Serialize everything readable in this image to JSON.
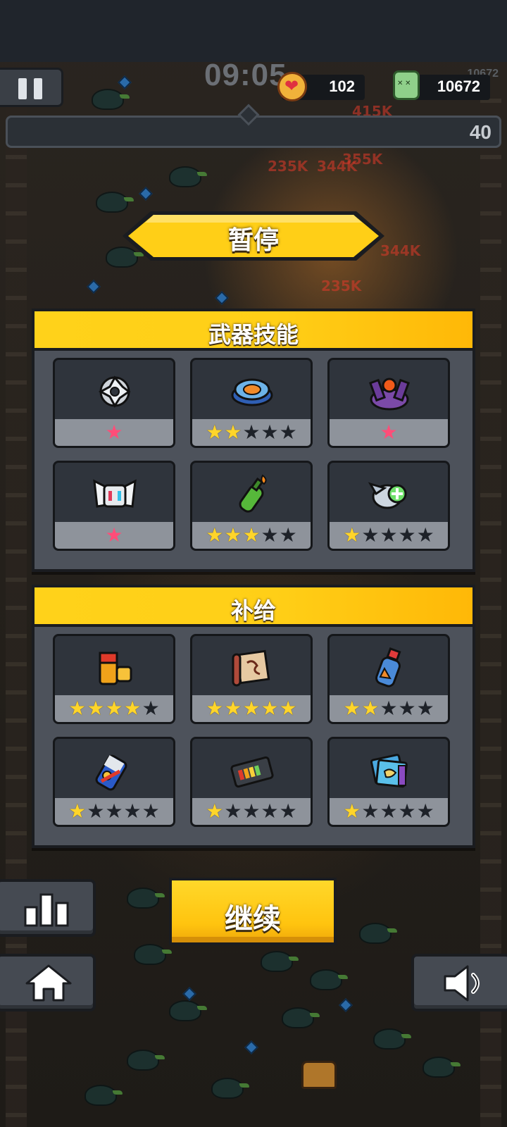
{
  "hud": {
    "timer": "09:05",
    "hearts": "102",
    "kills": "10672",
    "kills_ghost": "10672",
    "level": "40"
  },
  "pause_title": "暂停",
  "weapons": {
    "title": "武器技能",
    "items": [
      {
        "icon": "shuriken-icon",
        "stars": 1,
        "max": 1,
        "style": "pink"
      },
      {
        "icon": "spinner-disc-icon",
        "stars": 2,
        "max": 5,
        "style": "gold"
      },
      {
        "icon": "turret-icon",
        "stars": 1,
        "max": 1,
        "style": "pink"
      },
      {
        "icon": "robot-mask-icon",
        "stars": 1,
        "max": 1,
        "style": "pink"
      },
      {
        "icon": "molotov-bottle-icon",
        "stars": 3,
        "max": 5,
        "style": "gold"
      },
      {
        "icon": "drone-heal-icon",
        "stars": 1,
        "max": 5,
        "style": "gold"
      }
    ]
  },
  "supplies": {
    "title": "补给",
    "items": [
      {
        "icon": "battery-icon",
        "stars": 4,
        "max": 5
      },
      {
        "icon": "scroll-icon",
        "stars": 5,
        "max": 5
      },
      {
        "icon": "potion-bottle-icon",
        "stars": 2,
        "max": 5
      },
      {
        "icon": "energy-can-icon",
        "stars": 1,
        "max": 5
      },
      {
        "icon": "power-bank-icon",
        "stars": 1,
        "max": 5
      },
      {
        "icon": "map-book-icon",
        "stars": 1,
        "max": 5
      }
    ]
  },
  "continue_label": "继续",
  "buttons": {
    "stats": "stats-icon",
    "home": "home-icon",
    "sound": "speaker-icon"
  },
  "colors": {
    "accent_yellow": "#ffcf17",
    "panel": "#4d525b",
    "card": "#2f343c",
    "star_on": "#ffd52a",
    "star_pink": "#ff4d78"
  }
}
